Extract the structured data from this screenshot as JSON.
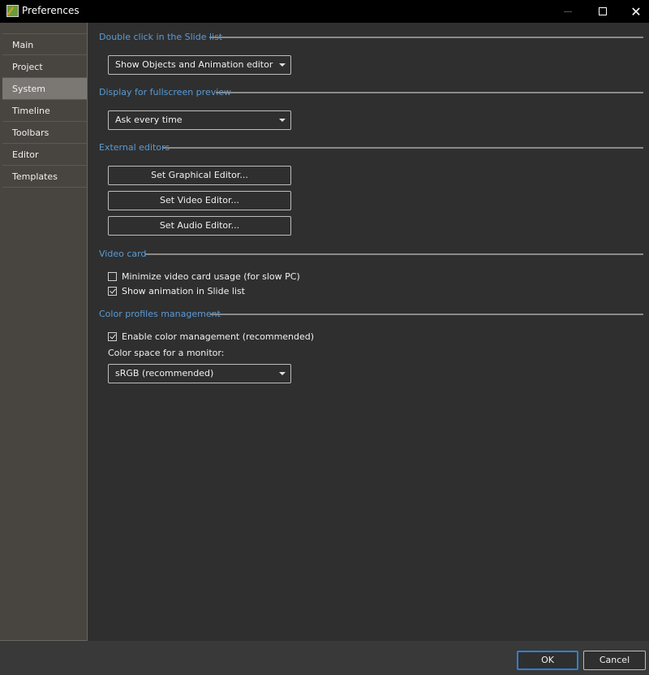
{
  "window": {
    "title": "Preferences",
    "app_icon": "app-icon",
    "controls": {
      "minimize": "minimize-icon",
      "maximize": "maximize-icon",
      "close": "close-icon",
      "close_glyph": "✕"
    }
  },
  "sidebar": {
    "items": [
      {
        "label": "Main",
        "active": false
      },
      {
        "label": "Project",
        "active": false
      },
      {
        "label": "System",
        "active": true
      },
      {
        "label": "Timeline",
        "active": false
      },
      {
        "label": "Toolbars",
        "active": false
      },
      {
        "label": "Editor",
        "active": false
      },
      {
        "label": "Templates",
        "active": false
      }
    ]
  },
  "sections": {
    "double_click": {
      "title": "Double click in the Slide list",
      "selected": "Show Objects and Animation editor"
    },
    "fullscreen": {
      "title": "Display for fullscreen preview",
      "selected": "Ask every time"
    },
    "external_editors": {
      "title": "External editors",
      "buttons": [
        "Set Graphical Editor...",
        "Set Video Editor...",
        "Set Audio Editor..."
      ]
    },
    "video_card": {
      "title": "Video card",
      "options": [
        {
          "label": "Minimize video card usage (for slow PC)",
          "checked": false
        },
        {
          "label": "Show animation in Slide list",
          "checked": true
        }
      ]
    },
    "color_profiles": {
      "title": "Color profiles management",
      "enable": {
        "label": "Enable color management (recommended)",
        "checked": true
      },
      "monitor_label": "Color space for a monitor:",
      "selected": "sRGB (recommended)"
    }
  },
  "footer": {
    "ok_label": "OK",
    "cancel_label": "Cancel"
  },
  "colors": {
    "accent": "#5b9bd5",
    "ok_border": "#2f7fd0",
    "sidebar_bg": "#48443f",
    "sidebar_active": "#7b7873",
    "content_bg": "#2f2f2f"
  }
}
